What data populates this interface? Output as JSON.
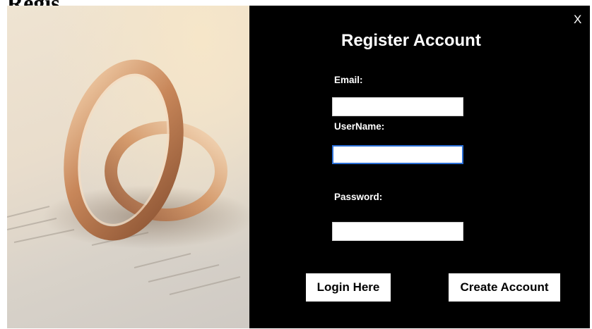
{
  "page": {
    "heading": "Regis"
  },
  "window": {
    "close_label": "X",
    "title": "Register Account"
  },
  "form": {
    "email": {
      "label": "Email:",
      "value": "",
      "placeholder": ""
    },
    "username": {
      "label": "UserName:",
      "value": "",
      "placeholder": ""
    },
    "password": {
      "label": "Password:",
      "value": "",
      "placeholder": ""
    }
  },
  "buttons": {
    "login": "Login Here",
    "create": "Create Account"
  },
  "hero": {
    "image": "wedding-rings-on-book-photo"
  },
  "colors": {
    "window_bg": "#000000",
    "text": "#ffffff",
    "input_bg": "#ffffff",
    "focus_border": "#2b6fd6",
    "ring_gold": "#c8956a"
  }
}
